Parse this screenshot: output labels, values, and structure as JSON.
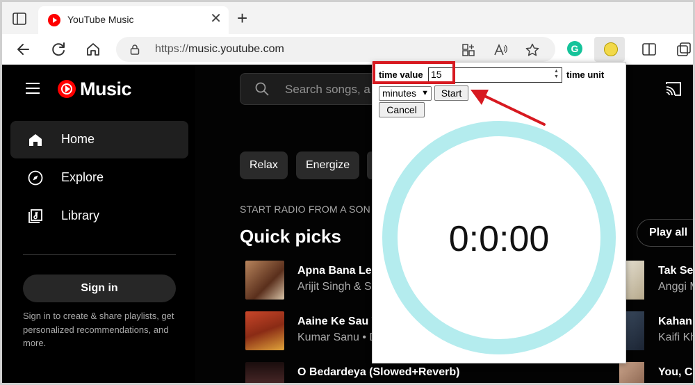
{
  "browser": {
    "tab_title": "YouTube Music",
    "new_tab": "+",
    "tab_close": "✕",
    "url_protocol": "https://",
    "url_host": "music.youtube.com",
    "grammarly_letter": "G"
  },
  "sidebar": {
    "logo_text": "Music",
    "items": [
      {
        "label": "Home",
        "icon": "home-icon",
        "active": true
      },
      {
        "label": "Explore",
        "icon": "compass-icon",
        "active": false
      },
      {
        "label": "Library",
        "icon": "library-icon",
        "active": false
      }
    ],
    "signin_label": "Sign in",
    "signin_hint": "Sign in to create & share playlists, get personalized recommendations, and more."
  },
  "main": {
    "search_placeholder": "Search songs, a",
    "chips": [
      "Relax",
      "Energize"
    ],
    "subheading": "START RADIO FROM A SON",
    "heading": "Quick picks",
    "play_all": "Play all",
    "songs": [
      {
        "title": "Apna Bana Le (",
        "artist": "Arijit Singh & Sa"
      },
      {
        "title": "Aaine Ke Sau T",
        "artist": "Kumar Sanu • D"
      },
      {
        "title": "O Bedardeya (Slowed+Reverb)",
        "artist": ""
      }
    ],
    "right_songs": [
      {
        "title": "Tak Seg",
        "artist": "Anggi M"
      },
      {
        "title": "Kahani",
        "artist": "Kaifi Kh"
      },
      {
        "title": "You, Cl",
        "artist": ""
      }
    ]
  },
  "timer_popup": {
    "time_value_label": "time value",
    "time_value": "15",
    "time_unit_label": "time unit",
    "unit_selected": "minutes",
    "start_label": "Start",
    "cancel_label": "Cancel",
    "display": "0:0:00",
    "ring_color": "#b4ecee"
  },
  "annotation": {
    "highlight_color": "#d71920"
  }
}
